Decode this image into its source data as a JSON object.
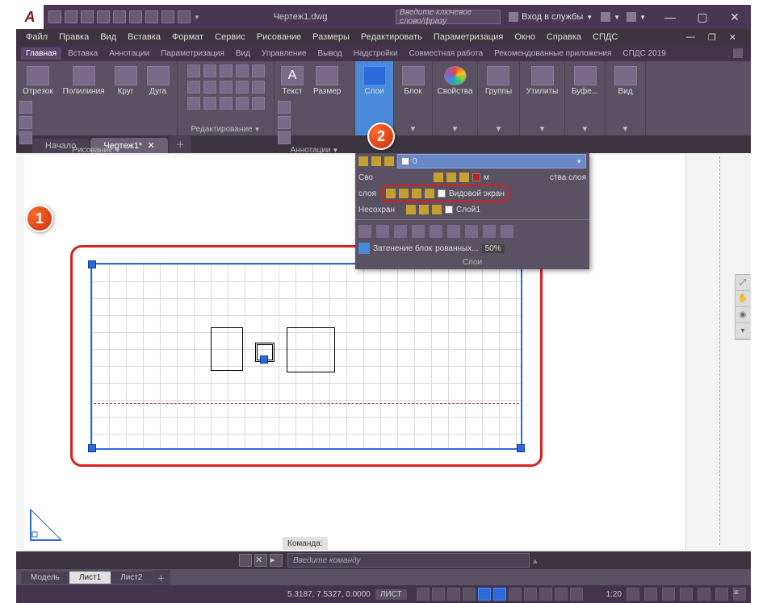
{
  "title": "Чертеж1.dwg",
  "search_placeholder": "Введите ключевое слово/фразу",
  "login_text": "Вход в службы",
  "menubar": [
    "Файл",
    "Правка",
    "Вид",
    "Вставка",
    "Формат",
    "Сервис",
    "Рисование",
    "Размеры",
    "Редактировать",
    "Параметризация",
    "Окно",
    "Справка",
    "СПДС"
  ],
  "ribbon_tabs": [
    "Главная",
    "Вставка",
    "Аннотации",
    "Параметризация",
    "Вид",
    "Управление",
    "Вывод",
    "Надстройки",
    "Совместная работа",
    "Рекомендованные приложения",
    "СПДС 2019"
  ],
  "ribbon_active_tab": "Главная",
  "panels": {
    "draw": {
      "label": "Рисование",
      "items": [
        "Отрезок",
        "Полилиния",
        "Круг",
        "Дуга"
      ]
    },
    "modify": {
      "label": "Редактирование"
    },
    "annot": {
      "label": "Аннотации",
      "items": [
        "Текст",
        "Размер"
      ]
    },
    "layer": {
      "label": "Слои"
    },
    "block": {
      "label": "Блок"
    },
    "props": {
      "label": "Свойства"
    },
    "groups": {
      "label": "Группы"
    },
    "utils": {
      "label": "Утилиты"
    },
    "clip": {
      "label": "Буфе..."
    },
    "view": {
      "label": "Вид"
    }
  },
  "doc_tabs": {
    "start": "Начало",
    "active": "Чертеж1*"
  },
  "layer_panel": {
    "current_layer": "0",
    "left_label_1": "Сво",
    "left_label_2": "слоя",
    "right_label": "ства слоя",
    "unsaved": "Несохран",
    "rows": [
      {
        "name": "м",
        "swatch": "#c02020"
      },
      {
        "name": "Видовой экран",
        "swatch": "#ffffff",
        "highlight": true
      },
      {
        "name": "Слой1",
        "swatch": "#ffffff"
      }
    ],
    "shade_label": "Затенение блок",
    "shade_mid": "рованных...",
    "shade_pct": "50%",
    "footer": "Слои"
  },
  "cmd_label": "Команда:",
  "cmd_placeholder": "Введите команду",
  "layout_tabs": [
    "Модель",
    "Лист1",
    "Лист2"
  ],
  "layout_active": "Лист1",
  "status": {
    "coords": "5.3187, 7.5327, 0.0000",
    "mode": "ЛИСТ",
    "zoom": "1:20"
  },
  "badges": {
    "one": "1",
    "two": "2"
  }
}
